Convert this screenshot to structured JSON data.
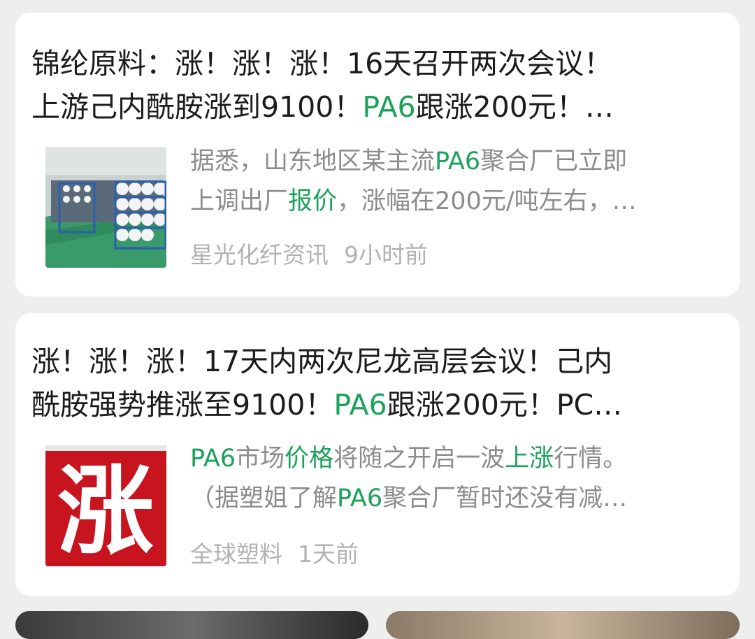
{
  "articles": [
    {
      "title_line1": "锦纶原料：涨！涨！涨！16天召开两次会议！",
      "title_line2_a": "上游己内酰胺涨到9100！",
      "title_line2_hl": "PA6",
      "title_line2_b": "跟涨200元！…",
      "snippet_line1_a": "据悉，山东地区某主流",
      "snippet_line1_hl": "PA6",
      "snippet_line1_b": "聚合厂已立即",
      "snippet_line2_a": "上调出厂",
      "snippet_line2_hl": "报价",
      "snippet_line2_b": "，涨幅在200元/吨左右，…",
      "source": "星光化纤资讯",
      "time": "9小时前",
      "thumbnail_icon": "factory-photo"
    },
    {
      "title_line1": "涨！涨！涨！17天内两次尼龙高层会议！己内",
      "title_line2_a": "酰胺强势推涨至9100！",
      "title_line2_hl": "PA6",
      "title_line2_b": "跟涨200元！PC…",
      "snippet_line1_hl1": "PA6",
      "snippet_line1_a": "市场",
      "snippet_line1_hl2": "价格",
      "snippet_line1_b": "将随之开启一波",
      "snippet_line1_hl3": "上涨",
      "snippet_line1_c": "行情。",
      "snippet_line2_a": "（据塑姐了解",
      "snippet_line2_hl": "PA6",
      "snippet_line2_b": "聚合厂暂时还没有减…",
      "source": "全球塑料",
      "time": "1天前",
      "thumbnail_text": "涨",
      "thumbnail_icon": "rise-character-image"
    }
  ],
  "colors": {
    "highlight": "#1aa25a",
    "background": "#eeeeee",
    "card": "#ffffff",
    "thumb_red": "#c8141e"
  }
}
